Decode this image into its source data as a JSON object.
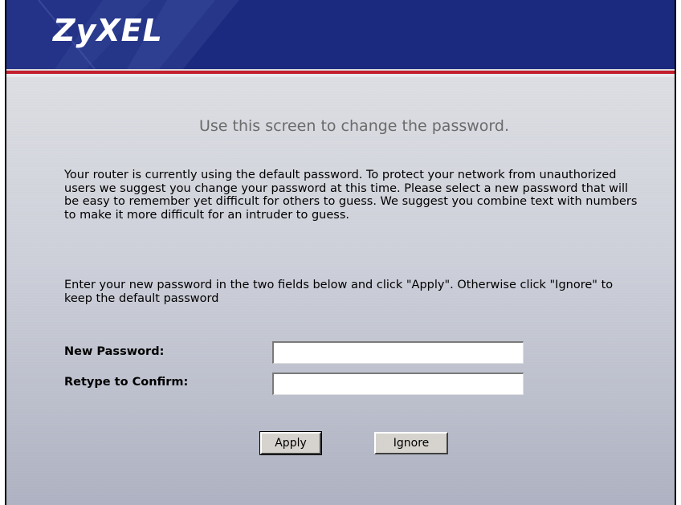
{
  "header": {
    "logo_text": "ZyXEL"
  },
  "main": {
    "title": "Use this screen to change the password.",
    "intro": "Your router is currently using the default password. To protect your network from unauthorized users we suggest you change your password at this time. Please select a new password that will be easy to remember yet difficult for others to guess. We suggest you combine text with numbers to make it more difficult for an intruder to guess.",
    "instructions": "Enter your new password in the two fields below and click \"Apply\". Otherwise click \"Ignore\" to keep the default password"
  },
  "form": {
    "new_password_label": "New Password:",
    "new_password_value": "",
    "confirm_label": "Retype to Confirm:",
    "confirm_value": ""
  },
  "buttons": {
    "apply_label": "Apply",
    "ignore_label": "Ignore"
  },
  "colors": {
    "header_blue": "#1b2a7e",
    "accent_red": "#c21e2e",
    "title_gray": "#6b6b6b"
  }
}
